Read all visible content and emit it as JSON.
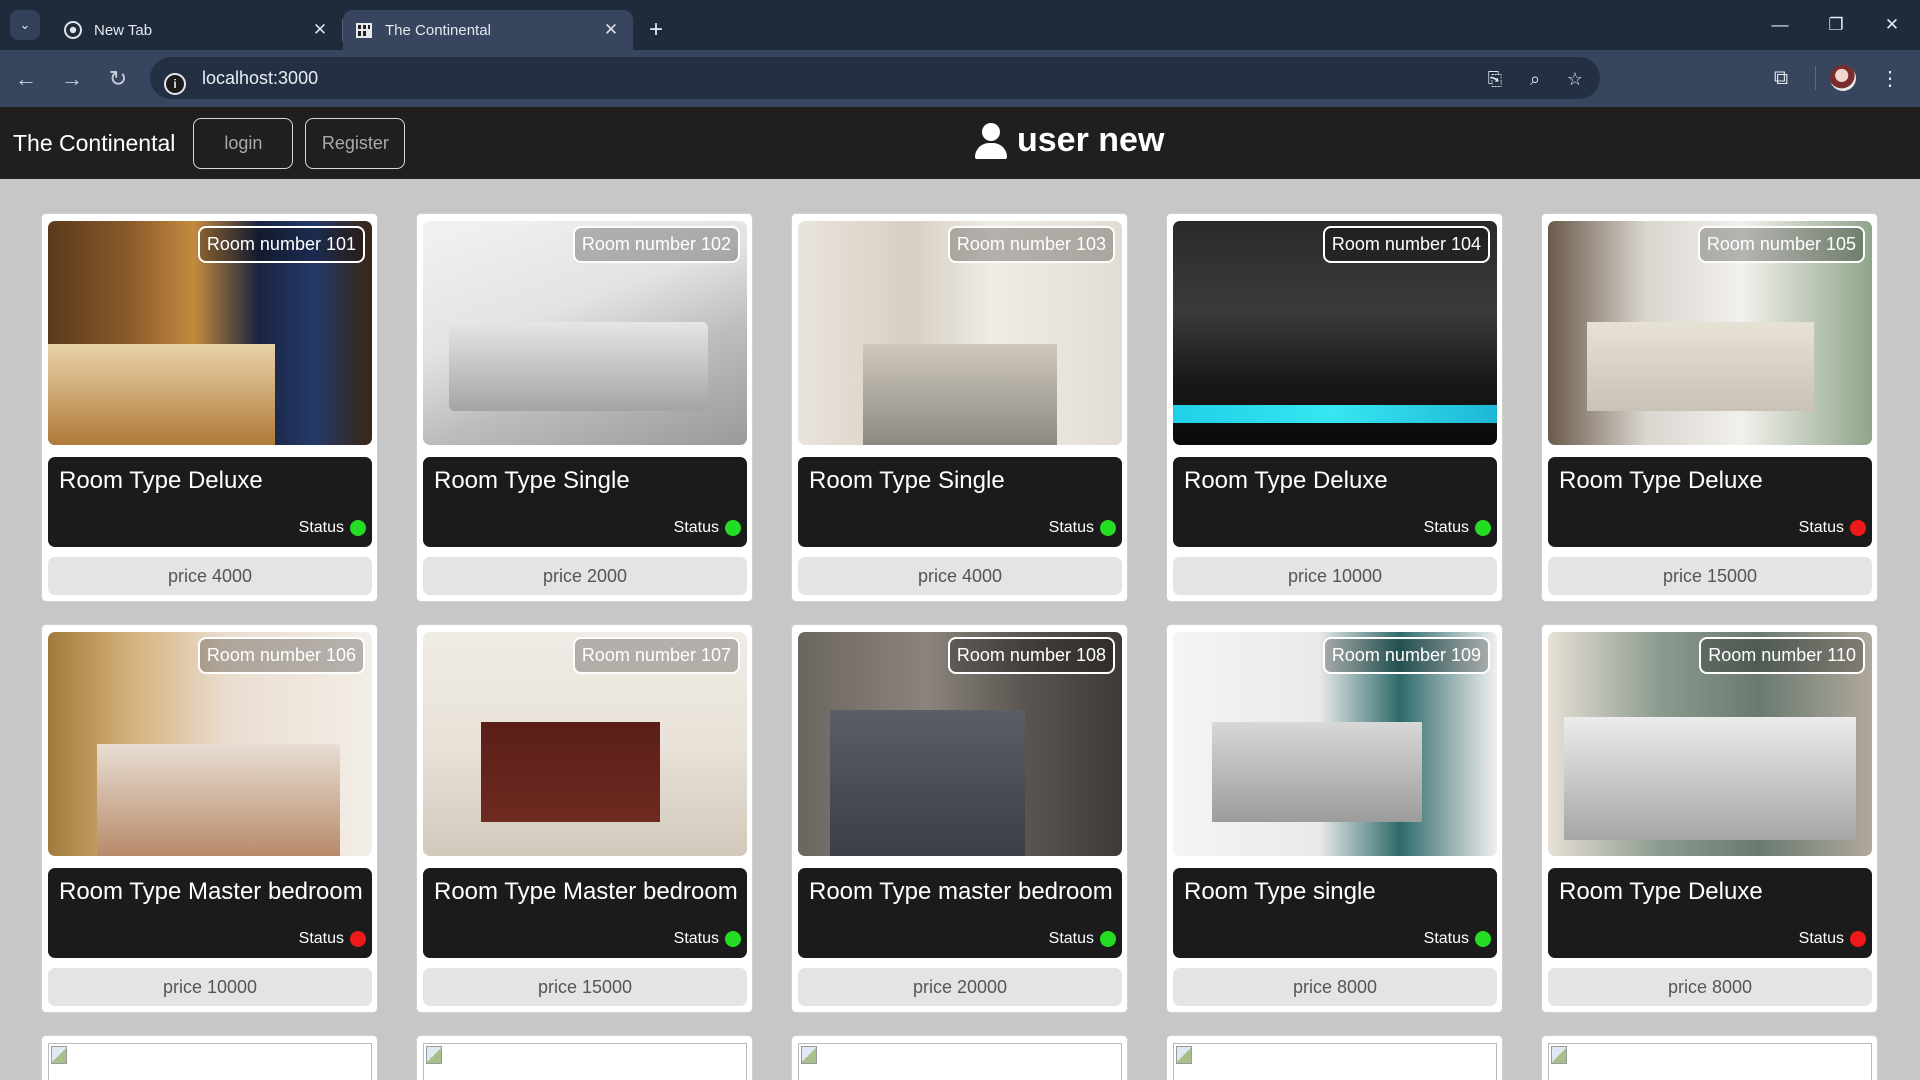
{
  "browser": {
    "tabs": [
      {
        "title": "New Tab",
        "icon": "chrome-icon"
      },
      {
        "title": "The Continental",
        "icon": "hotel-favicon",
        "active": true
      }
    ],
    "url": "localhost:3000"
  },
  "app": {
    "brand": "The Continental",
    "login_label": "login",
    "register_label": "Register",
    "user_name": "user new"
  },
  "status_label": "Status",
  "colors": {
    "available": "#22dd22",
    "occupied": "#ee1a1a",
    "header_bg": "#1f1f1f",
    "page_bg": "#c7c7c7"
  },
  "rooms": [
    {
      "number": "Room number 101",
      "type": "Room Type Deluxe",
      "price": "price 4000",
      "available": true
    },
    {
      "number": "Room number 102",
      "type": "Room Type Single",
      "price": "price 2000",
      "available": true
    },
    {
      "number": "Room number 103",
      "type": "Room Type Single",
      "price": "price 4000",
      "available": true
    },
    {
      "number": "Room number 104",
      "type": "Room Type Deluxe",
      "price": "price 10000",
      "available": true
    },
    {
      "number": "Room number 105",
      "type": "Room Type Deluxe",
      "price": "price 15000",
      "available": false
    },
    {
      "number": "Room number 106",
      "type": "Room Type Master bedroom",
      "price": "price 10000",
      "available": false
    },
    {
      "number": "Room number 107",
      "type": "Room Type Master bedroom",
      "price": "price 15000",
      "available": true
    },
    {
      "number": "Room number 108",
      "type": "Room Type master bedroom",
      "price": "price 20000",
      "available": true
    },
    {
      "number": "Room number 109",
      "type": "Room Type single",
      "price": "price 8000",
      "available": true
    },
    {
      "number": "Room number 110",
      "type": "Room Type Deluxe",
      "price": "price 8000",
      "available": false
    }
  ]
}
